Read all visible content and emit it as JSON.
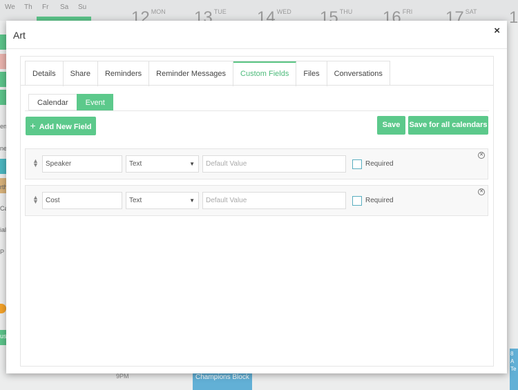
{
  "background": {
    "mini_days": [
      "We",
      "Th",
      "Fr",
      "Sa",
      "Su"
    ],
    "week_days": [
      {
        "num": "12",
        "dow": "MON"
      },
      {
        "num": "13",
        "dow": "TUE"
      },
      {
        "num": "14",
        "dow": "WED"
      },
      {
        "num": "15",
        "dow": "THU"
      },
      {
        "num": "16",
        "dow": "FRI"
      },
      {
        "num": "17",
        "dow": "SAT"
      },
      {
        "num": "1",
        "dow": ""
      }
    ],
    "time_label": "9PM",
    "event_text": "Champions Block",
    "left_fragments": [
      "ene",
      "ne",
      "rth",
      "Ca",
      "ial",
      "P",
      "use"
    ],
    "right_fragments": [
      "8",
      "A",
      "Te"
    ]
  },
  "modal": {
    "title": "Art",
    "close_glyph": "×",
    "tabs": [
      "Details",
      "Share",
      "Reminders",
      "Reminder Messages",
      "Custom Fields",
      "Files",
      "Conversations"
    ],
    "active_tab": "Custom Fields",
    "subtabs": [
      "Calendar",
      "Event"
    ],
    "active_subtab": "Event",
    "add_field_label": "Add New Field",
    "save_label": "Save",
    "save_all_label": "Save for all calendars",
    "fields": [
      {
        "name": "Speaker",
        "type": "Text",
        "default_placeholder": "Default Value",
        "required_label": "Required"
      },
      {
        "name": "Cost",
        "type": "Text",
        "default_placeholder": "Default Value",
        "required_label": "Required"
      }
    ]
  },
  "icons": {
    "plus": "plus-icon",
    "close": "close-icon",
    "drag": "drag-handle-icon",
    "dropdown": "chevron-down-icon",
    "remove": "remove-circle-icon"
  },
  "colors": {
    "accent": "#5cc98b",
    "accent_text": "#4cba7a",
    "checkbox_border": "#5aaec0",
    "event_blue": "#62b0d6"
  }
}
